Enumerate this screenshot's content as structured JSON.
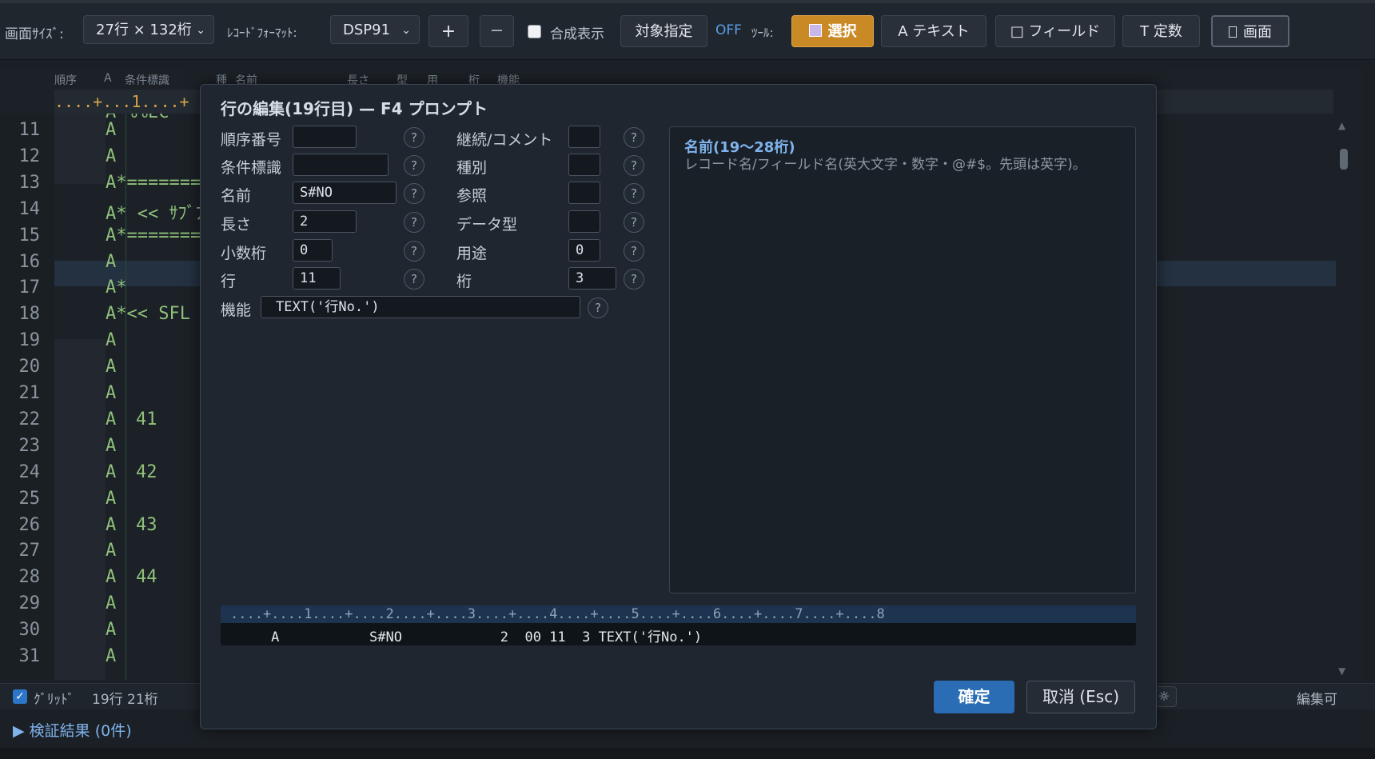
{
  "toolbar": {
    "screen_size_label": "画面ｻｲｽﾞ:",
    "screen_size_value": "27行 × 132桁",
    "record_format_label": "ﾚｺｰﾄﾞﾌｫｰﾏｯﾄ:",
    "record_format_value": "DSP91",
    "plus_label": "+",
    "minus_label": "－",
    "composite_label": "合成表示",
    "target_label": "対象指定",
    "off_label": "OFF",
    "tools_label": "ﾂｰﾙ:",
    "select_label": "選択",
    "text_label": "A テキスト",
    "field_label": "□ フィールド",
    "constant_label": "T 定数",
    "screen_label": "画面"
  },
  "editor": {
    "columns": [
      "順序",
      "A",
      "条件標識",
      "種",
      "名前",
      "長さ",
      "型",
      "用",
      "桁",
      "機能"
    ],
    "ruler": "....+...1....+",
    "partial_line": "A*%%EC",
    "lines": [
      {
        "num": "11",
        "text": "A"
      },
      {
        "num": "12",
        "text": "A"
      },
      {
        "num": "13",
        "text": "A*========"
      },
      {
        "num": "14",
        "text": "A* << ｻﾌﾞﾌ"
      },
      {
        "num": "15",
        "text": "A*========"
      },
      {
        "num": "16",
        "text": "A"
      },
      {
        "num": "17",
        "text": "A*"
      },
      {
        "num": "18",
        "text": "A*<< SFL R"
      },
      {
        "num": "19",
        "text": "A"
      },
      {
        "num": "20",
        "text": "A"
      },
      {
        "num": "21",
        "text": "A"
      },
      {
        "num": "22",
        "text": "A",
        "ind": "41"
      },
      {
        "num": "23",
        "text": "A"
      },
      {
        "num": "24",
        "text": "A",
        "ind": "42"
      },
      {
        "num": "25",
        "text": "A"
      },
      {
        "num": "26",
        "text": "A",
        "ind": "43"
      },
      {
        "num": "27",
        "text": "A"
      },
      {
        "num": "28",
        "text": "A",
        "ind": "44"
      },
      {
        "num": "29",
        "text": "A"
      },
      {
        "num": "30",
        "text": "A"
      },
      {
        "num": "31",
        "text": "A"
      }
    ]
  },
  "status": {
    "grid_label": "ｸﾞﾘｯﾄﾞ",
    "position": "19行 21桁",
    "editable": "編集可",
    "verify": "▶ 検証結果 (0件)"
  },
  "dialog": {
    "title": "行の編集(19行目) — F4 プロンプト",
    "fields": {
      "seq": {
        "label": "順序番号",
        "value": ""
      },
      "cond": {
        "label": "条件標識",
        "value": ""
      },
      "name": {
        "label": "名前",
        "value": "S#NO"
      },
      "length": {
        "label": "長さ",
        "value": "2"
      },
      "decimal": {
        "label": "小数桁",
        "value": "0"
      },
      "row": {
        "label": "行",
        "value": "11"
      },
      "cont": {
        "label": "継続/コメント",
        "value": ""
      },
      "kind": {
        "label": "種別",
        "value": ""
      },
      "ref": {
        "label": "参照",
        "value": ""
      },
      "dtype": {
        "label": "データ型",
        "value": ""
      },
      "usage": {
        "label": "用途",
        "value": "0"
      },
      "col": {
        "label": "桁",
        "value": "3"
      },
      "func": {
        "label": "機能",
        "value": "TEXT('行No.')"
      }
    },
    "help_glyph": "?",
    "help_title": "名前(19〜28桁)",
    "help_body": "レコード名/フィールド名(英大文字・数字・@#$。先頭は英字)。",
    "preview_ruler": "....+....1....+....2....+....3....+....4....+....5....+....6....+....7....+....8",
    "preview_line": "     A           S#NO            2  00 11  3 TEXT('行No.')",
    "ok_label": "確定",
    "cancel_label": "取消 (Esc)"
  }
}
